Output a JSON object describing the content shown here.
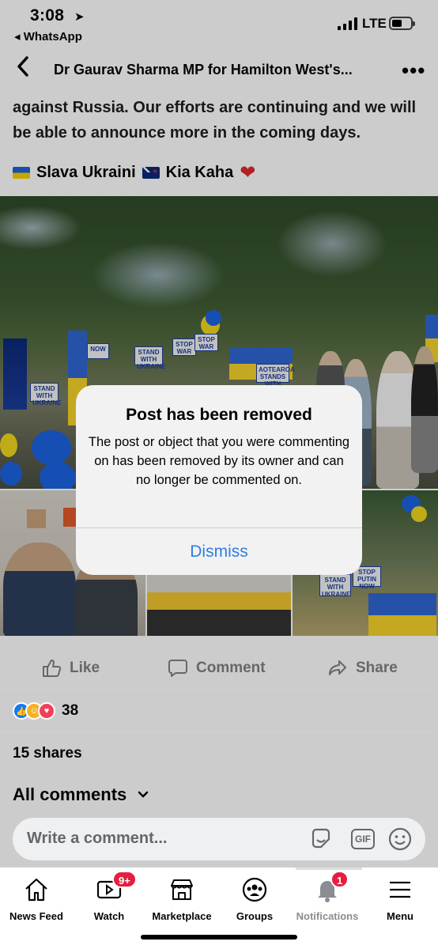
{
  "status_bar": {
    "time": "3:08",
    "back_app": "◂ WhatsApp",
    "network": "LTE",
    "battery_level": 0.55
  },
  "nav": {
    "title": "Dr Gaurav Sharma MP for Hamilton West's..."
  },
  "post": {
    "text_lines": [
      "against Russia. Our efforts are continuing and we will",
      "be able to announce more in the coming days."
    ],
    "tag_slava": "Slava Ukraini",
    "tag_kia": "Kia Kaha",
    "photo_signs": [
      "STAND WITH UKRAINE",
      "STOP WAR",
      "STAND WITH UKRAINE",
      "NOW",
      "AOTEAROA STANDS WITH UKRAINE",
      "STOP PUTIN NOW",
      "STOP WAR"
    ]
  },
  "actions": {
    "like": "Like",
    "comment": "Comment",
    "share": "Share"
  },
  "reactions": {
    "count": "38"
  },
  "shares": "15 shares",
  "comments": {
    "filter_label": "All comments",
    "placeholder": "Write a comment..."
  },
  "alert": {
    "title": "Post has been removed",
    "message": "The post or object that you were commenting on has been removed by its owner and can no longer be commented on.",
    "dismiss": "Dismiss"
  },
  "tabs": [
    {
      "label": "News Feed",
      "icon": "home-icon"
    },
    {
      "label": "Watch",
      "icon": "watch-icon",
      "badge": "9+"
    },
    {
      "label": "Marketplace",
      "icon": "marketplace-icon"
    },
    {
      "label": "Groups",
      "icon": "groups-icon"
    },
    {
      "label": "Notifications",
      "icon": "bell-icon",
      "badge": "1"
    },
    {
      "label": "Menu",
      "icon": "menu-icon"
    }
  ],
  "colors": {
    "facebook_blue": "#1877f2",
    "ios_link_blue": "#2f7de1",
    "badge_red": "#e41e3f"
  }
}
